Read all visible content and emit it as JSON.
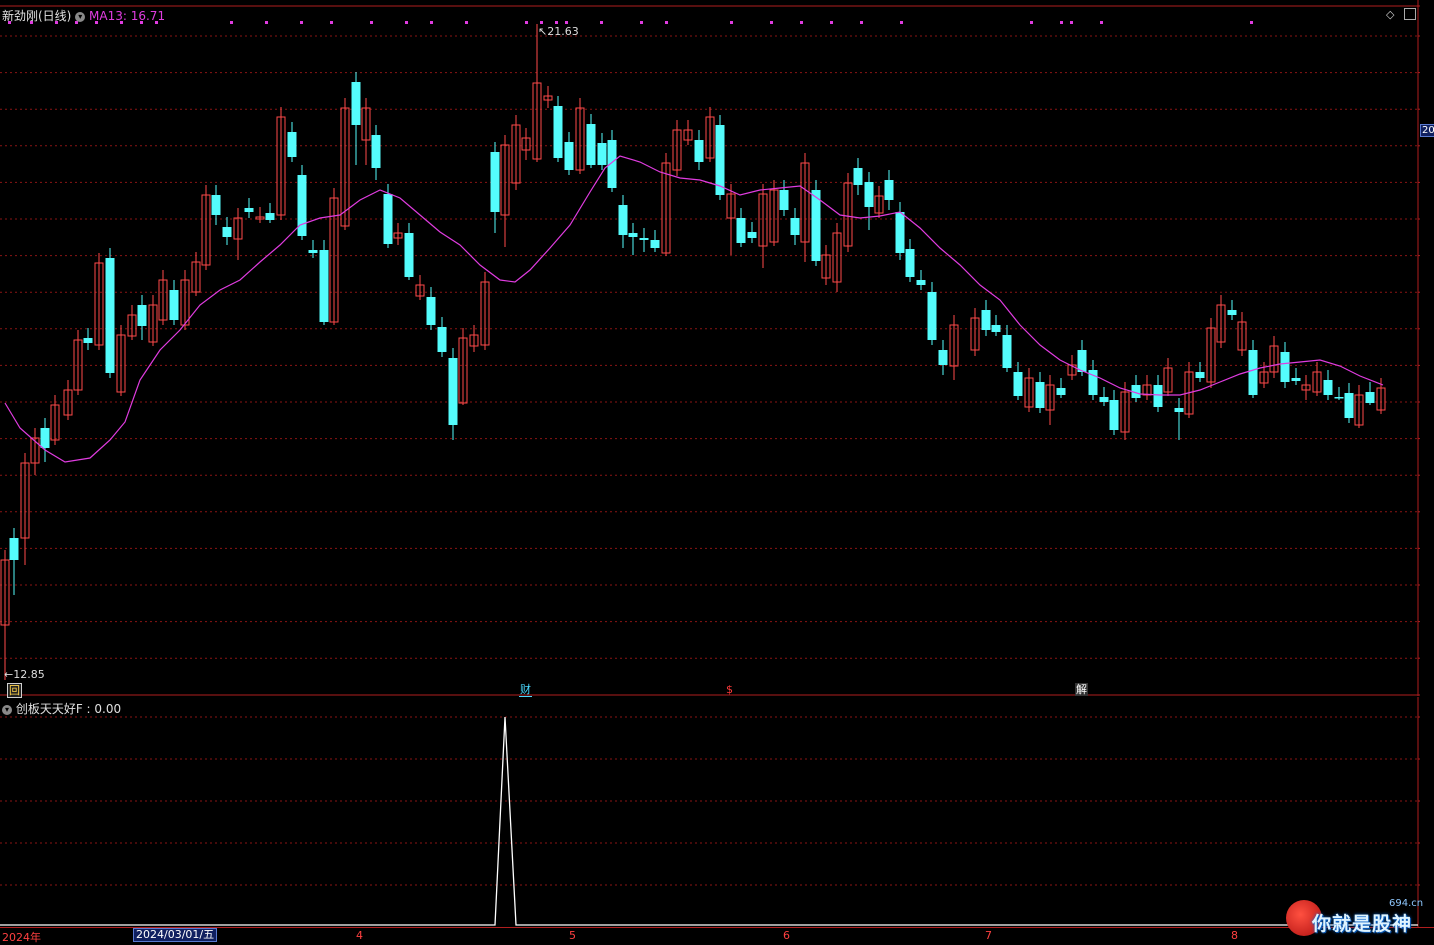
{
  "main_panel": {
    "stock_title": "新劲刚(日线)",
    "ma_label": "MA13: 16.71",
    "high_label": "21.63",
    "low_label": "12.85",
    "colors": {
      "bg": "#000000",
      "up": "#ff4a4a",
      "down": "#54fcfc",
      "ma": "#e03ce0",
      "grid": "#8a1414",
      "axis": "#b01e1e"
    }
  },
  "event_markers": {
    "box": "回",
    "fin": "财",
    "s": "$",
    "jie": "解"
  },
  "indicator_panel": {
    "title": "创板天天好F : 0.00"
  },
  "time_axis": {
    "year_label": "2024年",
    "cursor_date": "2024/03/01/五",
    "month_labels": [
      "4",
      "5",
      "6",
      "7",
      "8"
    ]
  },
  "price_axis": {
    "visible_tag": "20"
  },
  "watermark": {
    "text": "你就是股神",
    "sub": "694.cn"
  },
  "chart_data": {
    "type": "candlestick",
    "title": "新劲刚(日线)",
    "overlay": "MA13",
    "y_range": [
      12.85,
      21.63
    ],
    "indicator": {
      "name": "创板天天好F",
      "value": 0.0
    }
  }
}
